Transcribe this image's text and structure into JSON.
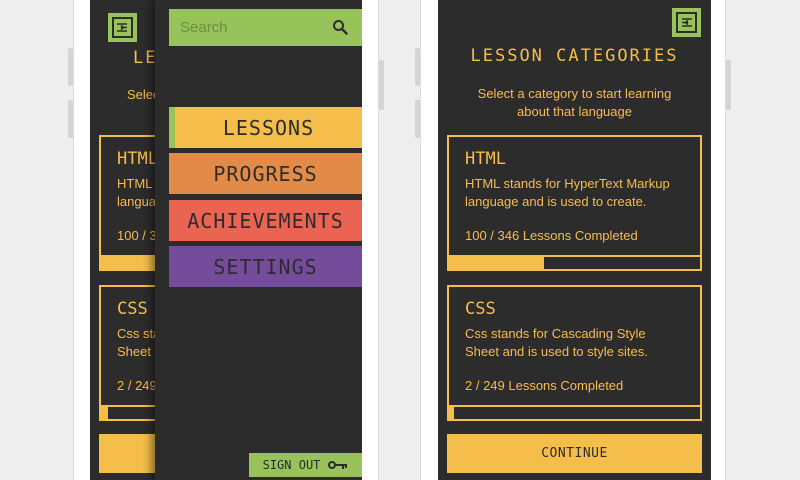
{
  "colors": {
    "screen_bg": "#2d2c2d",
    "accent_yellow": "#f5be4a",
    "accent_green": "#97c35a",
    "nav_lessons": "#f5be4a",
    "nav_progress": "#e28a48",
    "nav_achievements": "#ea6451",
    "nav_settings": "#744c9b"
  },
  "left_screen": {
    "title_fragment": "LES",
    "subtitle_fragment": "Selec",
    "cards": [
      {
        "title": "HTML",
        "desc_line1": "HTML",
        "desc_line2": "langua",
        "count": "100 / 3"
      },
      {
        "title": "CSS",
        "desc_line1": "Css sta",
        "desc_line2": "Sheet a",
        "count": "2 / 249"
      }
    ]
  },
  "drawer": {
    "search_placeholder": "Search",
    "nav": [
      {
        "label": "LESSONS",
        "color": "#f5be4a"
      },
      {
        "label": "PROGRESS",
        "color": "#e28a48"
      },
      {
        "label": "ACHIEVEMENTS",
        "color": "#ea6451"
      },
      {
        "label": "SETTINGS",
        "color": "#744c9b"
      }
    ],
    "signout_label": "SIGN OUT"
  },
  "right_screen": {
    "title": "LESSON CATEGORIES",
    "subtitle_line1": "Select a category to start learning",
    "subtitle_line2": "about that language",
    "cards": [
      {
        "title": "HTML",
        "desc_line1": "HTML stands for HyperText Markup",
        "desc_line2": "language and is used to create.",
        "count": "100 / 346 Lessons Completed",
        "progress": 0.38
      },
      {
        "title": "CSS",
        "desc_line1": "Css stands for Cascading Style",
        "desc_line2": "Sheet and is used to style sites.",
        "count": "2 / 249 Lessons Completed",
        "progress": 0.02
      }
    ],
    "continue_label": "CONTINUE"
  }
}
